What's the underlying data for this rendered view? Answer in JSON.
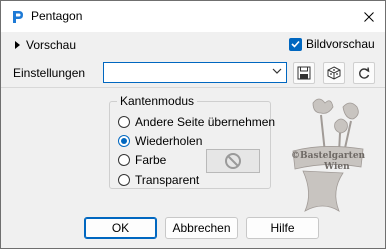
{
  "window": {
    "title": "Pentagon"
  },
  "toolbar": {
    "preview_label": "Vorschau",
    "bildvorschau_label": "Bildvorschau",
    "bildvorschau_checked": true
  },
  "settings": {
    "label": "Einstellungen",
    "value": ""
  },
  "edge_mode": {
    "title": "Kantenmodus",
    "options": [
      {
        "label": "Andere Seite übernehmen",
        "checked": false
      },
      {
        "label": "Wiederholen",
        "checked": true
      },
      {
        "label": "Farbe",
        "checked": false
      },
      {
        "label": "Transparent",
        "checked": false
      }
    ]
  },
  "buttons": {
    "ok": "OK",
    "cancel": "Abbrechen",
    "help": "Hilfe"
  },
  "watermark": {
    "line1": "©Bastelgarten",
    "line2": "Wien"
  },
  "colors": {
    "accent": "#0067c0",
    "background": "#f0f0f0"
  }
}
